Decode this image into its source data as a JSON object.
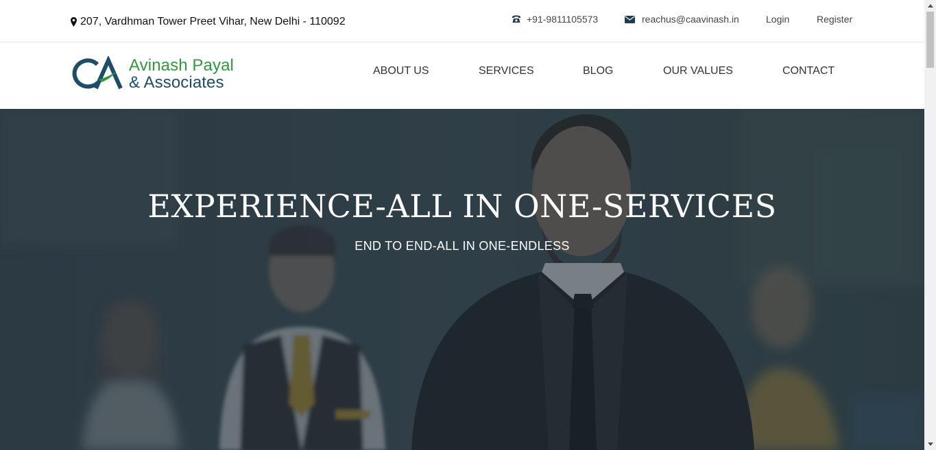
{
  "topbar": {
    "address": "207, Vardhman Tower Preet Vihar, New Delhi - 110092",
    "address_icon": "map-marker-icon",
    "phone": "+91-9811105573",
    "phone_icon": "phone-icon",
    "email": "reachus@caavinash.in",
    "email_icon": "envelope-icon",
    "login": "Login",
    "register": "Register"
  },
  "logo": {
    "monogram": "CA",
    "line1": "Avinash Payal",
    "line2": "& Associates",
    "colors": {
      "green": "#2e9a3c",
      "navy": "#1e4d6b"
    }
  },
  "nav": {
    "items": [
      "ABOUT US",
      "SERVICES",
      "BLOG",
      "OUR VALUES",
      "CONTACT"
    ]
  },
  "hero": {
    "title": "EXPERIENCE-ALL IN ONE-SERVICES",
    "subtitle": "END TO END-ALL IN ONE-ENDLESS",
    "overlay_color": "#2b3a44"
  }
}
